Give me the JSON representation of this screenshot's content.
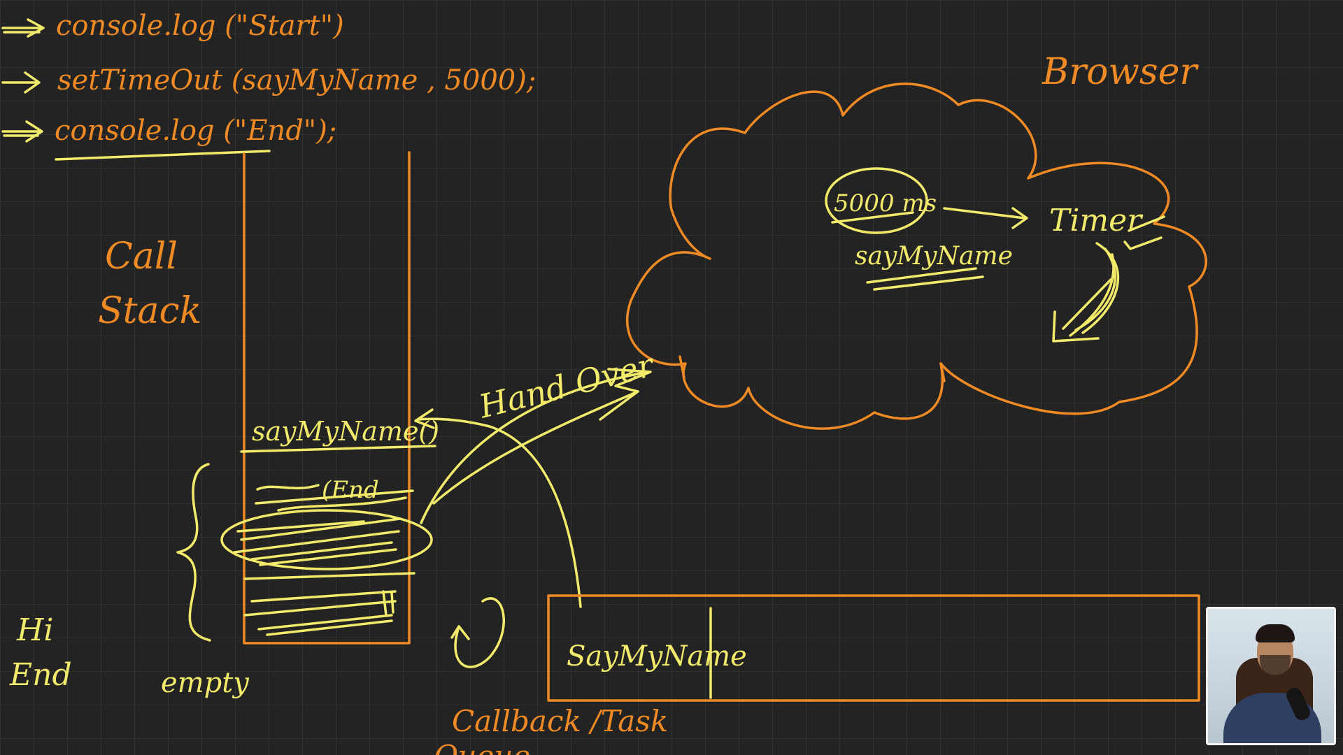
{
  "code": {
    "line1": "console.log (\"Start\")",
    "line2": "setTimeOut (sayMyName , 5000);",
    "line3": "console.log (\"End\");"
  },
  "labels": {
    "call_stack_1": "Call",
    "call_stack_2": "Stack",
    "browser": "Browser",
    "timer": "Timer",
    "delay": "5000 ms",
    "browser_callback": "sayMyName",
    "hand_over": "Hand Over",
    "stack_top": "sayMyName()",
    "stack_end": "(End",
    "empty": "empty",
    "output_1": "Hi",
    "output_2": "End",
    "queue_item": "SayMyName",
    "queue_label": "Callback /Task",
    "queue_label_2": "Queue"
  },
  "colors": {
    "orange_ink": "#f08a24",
    "yellow_ink": "#f2ea6a",
    "background": "#232323"
  }
}
